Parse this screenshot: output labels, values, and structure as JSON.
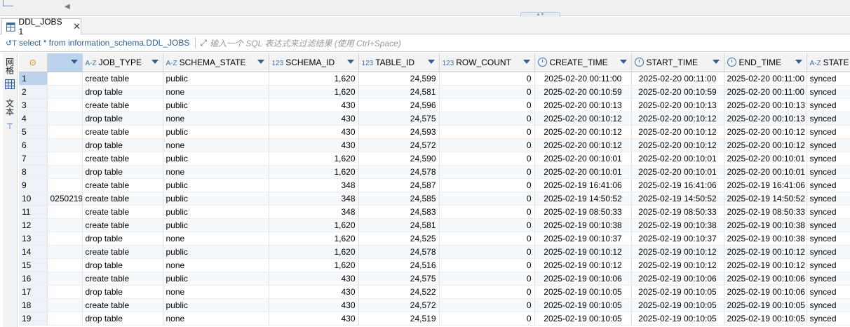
{
  "tab": {
    "title": "DDL_JOBS 1",
    "close": "✕"
  },
  "filter": {
    "query": "select * from information_schema.DDL_JOBS",
    "placeholder": "输入一个 SQL 表达式来过滤结果 (使用 Ctrl+Space)"
  },
  "sidebar": {
    "grid_label": "网格",
    "text_label": "文本"
  },
  "columns": [
    {
      "type": "A-Z",
      "name": "JOB_TYPE"
    },
    {
      "type": "A-Z",
      "name": "SCHEMA_STATE"
    },
    {
      "type": "123",
      "name": "SCHEMA_ID"
    },
    {
      "type": "123",
      "name": "TABLE_ID"
    },
    {
      "type": "123",
      "name": "ROW_COUNT"
    },
    {
      "type": "clock",
      "name": "CREATE_TIME"
    },
    {
      "type": "clock",
      "name": "START_TIME"
    },
    {
      "type": "clock",
      "name": "END_TIME"
    },
    {
      "type": "A-Z",
      "name": "STATE"
    }
  ],
  "rows": [
    {
      "n": "1",
      "extra": "",
      "job_type": "create table",
      "schema_state": "public",
      "schema_id": "1,620",
      "table_id": "24,599",
      "row_count": "0",
      "create_time": "2025-02-20 00:11:00",
      "start_time": "2025-02-20 00:11:00",
      "end_time": "2025-02-20 00:11:00",
      "state": "synced"
    },
    {
      "n": "2",
      "extra": "",
      "job_type": "drop table",
      "schema_state": "none",
      "schema_id": "1,620",
      "table_id": "24,581",
      "row_count": "0",
      "create_time": "2025-02-20 00:10:59",
      "start_time": "2025-02-20 00:10:59",
      "end_time": "2025-02-20 00:11:00",
      "state": "synced"
    },
    {
      "n": "3",
      "extra": "",
      "job_type": "create table",
      "schema_state": "public",
      "schema_id": "430",
      "table_id": "24,596",
      "row_count": "0",
      "create_time": "2025-02-20 00:10:13",
      "start_time": "2025-02-20 00:10:13",
      "end_time": "2025-02-20 00:10:13",
      "state": "synced"
    },
    {
      "n": "4",
      "extra": "",
      "job_type": "drop table",
      "schema_state": "none",
      "schema_id": "430",
      "table_id": "24,575",
      "row_count": "0",
      "create_time": "2025-02-20 00:10:12",
      "start_time": "2025-02-20 00:10:12",
      "end_time": "2025-02-20 00:10:13",
      "state": "synced"
    },
    {
      "n": "5",
      "extra": "",
      "job_type": "create table",
      "schema_state": "public",
      "schema_id": "430",
      "table_id": "24,593",
      "row_count": "0",
      "create_time": "2025-02-20 00:10:12",
      "start_time": "2025-02-20 00:10:12",
      "end_time": "2025-02-20 00:10:12",
      "state": "synced"
    },
    {
      "n": "6",
      "extra": "",
      "job_type": "drop table",
      "schema_state": "none",
      "schema_id": "430",
      "table_id": "24,572",
      "row_count": "0",
      "create_time": "2025-02-20 00:10:12",
      "start_time": "2025-02-20 00:10:12",
      "end_time": "2025-02-20 00:10:12",
      "state": "synced"
    },
    {
      "n": "7",
      "extra": "",
      "job_type": "create table",
      "schema_state": "public",
      "schema_id": "1,620",
      "table_id": "24,590",
      "row_count": "0",
      "create_time": "2025-02-20 00:10:01",
      "start_time": "2025-02-20 00:10:01",
      "end_time": "2025-02-20 00:10:01",
      "state": "synced"
    },
    {
      "n": "8",
      "extra": "",
      "job_type": "drop table",
      "schema_state": "none",
      "schema_id": "1,620",
      "table_id": "24,578",
      "row_count": "0",
      "create_time": "2025-02-20 00:10:01",
      "start_time": "2025-02-20 00:10:01",
      "end_time": "2025-02-20 00:10:01",
      "state": "synced"
    },
    {
      "n": "9",
      "extra": "",
      "job_type": "create table",
      "schema_state": "public",
      "schema_id": "348",
      "table_id": "24,587",
      "row_count": "0",
      "create_time": "2025-02-19 16:41:06",
      "start_time": "2025-02-19 16:41:06",
      "end_time": "2025-02-19 16:41:06",
      "state": "synced"
    },
    {
      "n": "10",
      "extra": "0250219",
      "job_type": "create table",
      "schema_state": "public",
      "schema_id": "348",
      "table_id": "24,585",
      "row_count": "0",
      "create_time": "2025-02-19 14:50:52",
      "start_time": "2025-02-19 14:50:52",
      "end_time": "2025-02-19 14:50:52",
      "state": "synced"
    },
    {
      "n": "11",
      "extra": "",
      "job_type": "create table",
      "schema_state": "public",
      "schema_id": "348",
      "table_id": "24,583",
      "row_count": "0",
      "create_time": "2025-02-19 08:50:33",
      "start_time": "2025-02-19 08:50:33",
      "end_time": "2025-02-19 08:50:33",
      "state": "synced"
    },
    {
      "n": "12",
      "extra": "",
      "job_type": "create table",
      "schema_state": "public",
      "schema_id": "1,620",
      "table_id": "24,581",
      "row_count": "0",
      "create_time": "2025-02-19 00:10:38",
      "start_time": "2025-02-19 00:10:38",
      "end_time": "2025-02-19 00:10:38",
      "state": "synced"
    },
    {
      "n": "13",
      "extra": "",
      "job_type": "drop table",
      "schema_state": "none",
      "schema_id": "1,620",
      "table_id": "24,525",
      "row_count": "0",
      "create_time": "2025-02-19 00:10:37",
      "start_time": "2025-02-19 00:10:37",
      "end_time": "2025-02-19 00:10:38",
      "state": "synced"
    },
    {
      "n": "14",
      "extra": "",
      "job_type": "create table",
      "schema_state": "public",
      "schema_id": "1,620",
      "table_id": "24,578",
      "row_count": "0",
      "create_time": "2025-02-19 00:10:12",
      "start_time": "2025-02-19 00:10:12",
      "end_time": "2025-02-19 00:10:12",
      "state": "synced"
    },
    {
      "n": "15",
      "extra": "",
      "job_type": "drop table",
      "schema_state": "none",
      "schema_id": "1,620",
      "table_id": "24,516",
      "row_count": "0",
      "create_time": "2025-02-19 00:10:12",
      "start_time": "2025-02-19 00:10:12",
      "end_time": "2025-02-19 00:10:12",
      "state": "synced"
    },
    {
      "n": "16",
      "extra": "",
      "job_type": "create table",
      "schema_state": "public",
      "schema_id": "430",
      "table_id": "24,575",
      "row_count": "0",
      "create_time": "2025-02-19 00:10:06",
      "start_time": "2025-02-19 00:10:06",
      "end_time": "2025-02-19 00:10:06",
      "state": "synced"
    },
    {
      "n": "17",
      "extra": "",
      "job_type": "drop table",
      "schema_state": "none",
      "schema_id": "430",
      "table_id": "24,522",
      "row_count": "0",
      "create_time": "2025-02-19 00:10:05",
      "start_time": "2025-02-19 00:10:05",
      "end_time": "2025-02-19 00:10:06",
      "state": "synced"
    },
    {
      "n": "18",
      "extra": "",
      "job_type": "create table",
      "schema_state": "public",
      "schema_id": "430",
      "table_id": "24,572",
      "row_count": "0",
      "create_time": "2025-02-19 00:10:05",
      "start_time": "2025-02-19 00:10:05",
      "end_time": "2025-02-19 00:10:05",
      "state": "synced"
    },
    {
      "n": "19",
      "extra": "",
      "job_type": "drop table",
      "schema_state": "none",
      "schema_id": "430",
      "table_id": "24,519",
      "row_count": "0",
      "create_time": "2025-02-19 00:10:05",
      "start_time": "2025-02-19 00:10:05",
      "end_time": "2025-02-19 00:10:05",
      "state": "synced"
    }
  ],
  "colors": {
    "selection": "#bcd3ee",
    "accent": "#2f5f96"
  }
}
